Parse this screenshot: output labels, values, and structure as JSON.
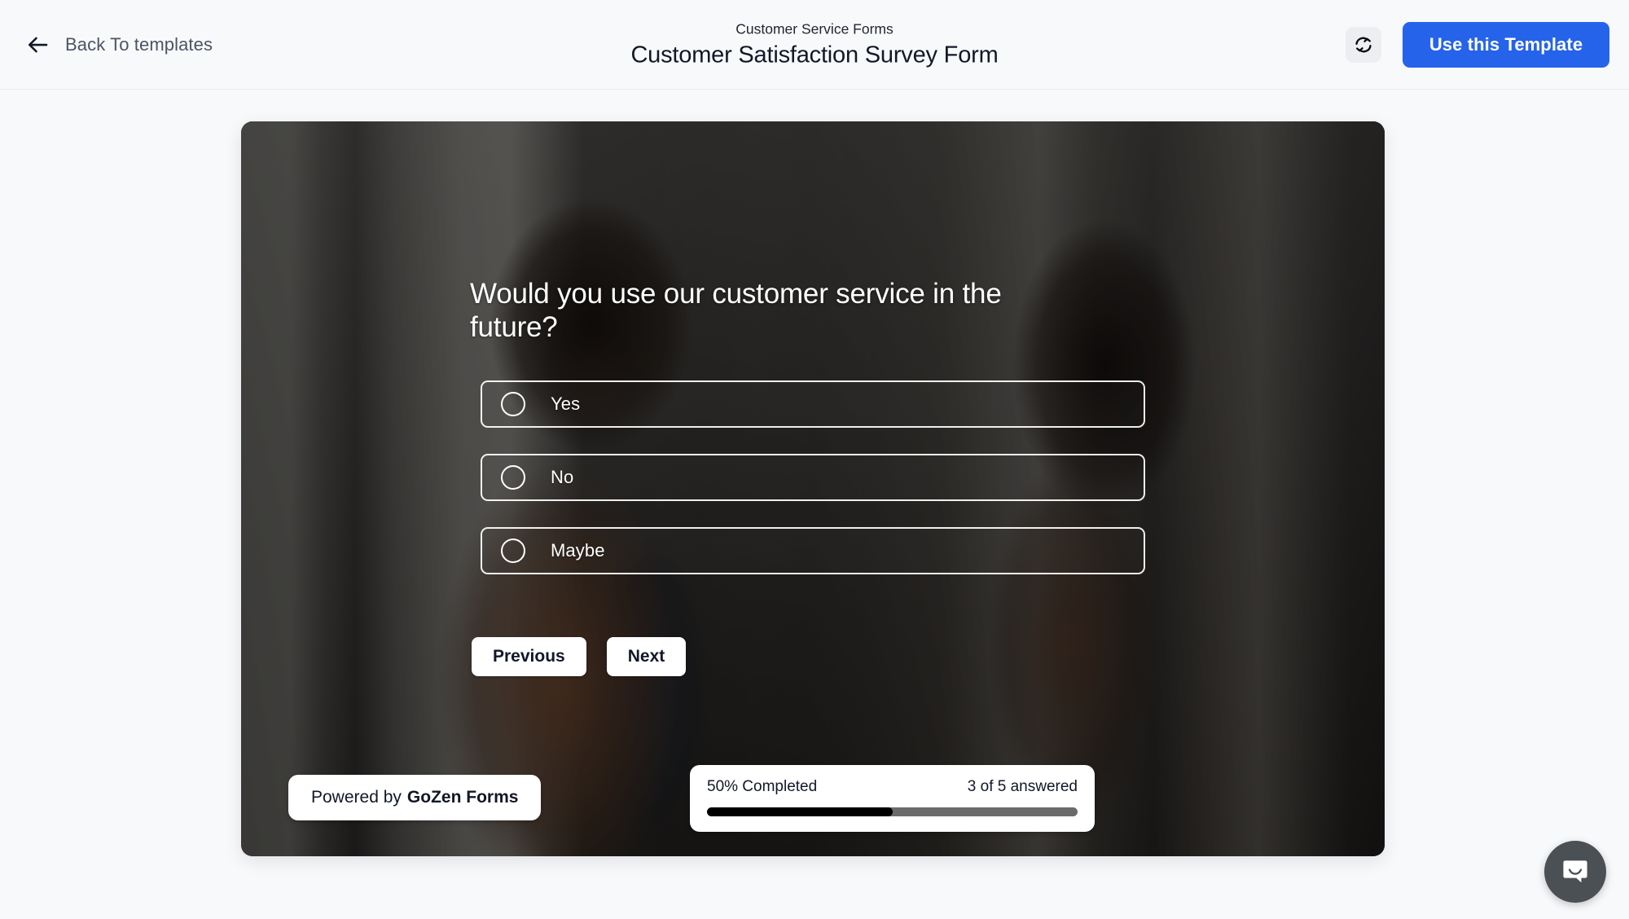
{
  "header": {
    "back_label": "Back To templates",
    "back_icon": "arrow-left-icon",
    "form_category": "Customer Service Forms",
    "form_title": "Customer Satisfaction Survey Form",
    "refresh_icon": "refresh-sync-icon",
    "use_template_label": "Use this Template",
    "accent_color": "#2563eb"
  },
  "form": {
    "question": "Would you use our customer service in the future?",
    "options": [
      {
        "label": "Yes",
        "selected": false
      },
      {
        "label": "No",
        "selected": false
      },
      {
        "label": "Maybe",
        "selected": false
      }
    ],
    "previous_label": "Previous",
    "next_label": "Next"
  },
  "footer": {
    "powered_prefix": "Powered by",
    "powered_brand": "GoZen Forms",
    "progress_label": "50% Completed",
    "answered_label": "3 of 5 answered",
    "progress_percent": 50,
    "fill_color": "#000000",
    "track_color": "#6b6b6b"
  },
  "chat": {
    "icon": "chat-bubble-smile-icon",
    "background_color": "#4b5055"
  }
}
